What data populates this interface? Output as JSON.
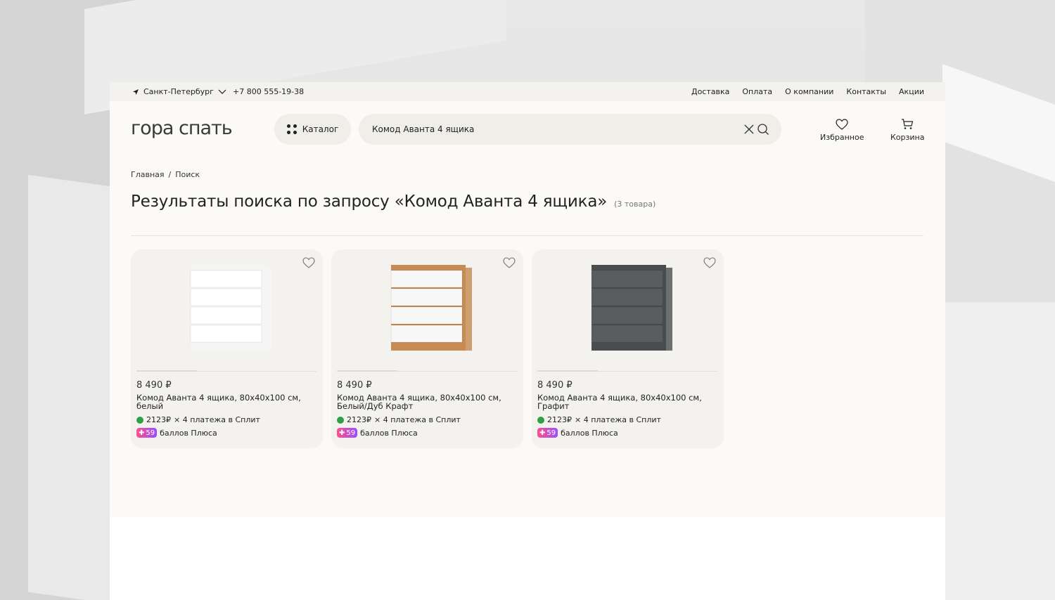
{
  "topbar": {
    "city": "Санкт-Петербург",
    "phone": "+7 800 555-19-38",
    "links": [
      "Доставка",
      "Оплата",
      "О компании",
      "Контакты",
      "Акции"
    ]
  },
  "header": {
    "logo": "гора спать",
    "catalog_label": "Каталог",
    "search_value": "Комод Аванта 4 ящика",
    "favorites_label": "Избранное",
    "cart_label": "Корзина"
  },
  "breadcrumb": {
    "home": "Главная",
    "sep": "/",
    "current": "Поиск"
  },
  "results": {
    "title": "Результаты поиска по запросу «Комод Аванта 4 ящика»",
    "count": "(3 товара)"
  },
  "products": [
    {
      "price": "8 490 ₽",
      "name": "Комод Аванта 4 ящика, 80х40х100 см, белый",
      "split_amount": "2123₽",
      "split_text": "× 4 платежа в Сплит",
      "plus_points": "59",
      "plus_text": "баллов Плюса",
      "body_color": "#f5f5f5",
      "front_color": "#ffffff"
    },
    {
      "price": "8 490 ₽",
      "name": "Комод Аванта 4 ящика, 80х40х100 см, Белый/Дуб Крафт",
      "split_amount": "2123₽",
      "split_text": "× 4 платежа в Сплит",
      "plus_points": "59",
      "plus_text": "баллов Плюса",
      "body_color": "#c68a52",
      "front_color": "#f7f7f7"
    },
    {
      "price": "8 490 ₽",
      "name": "Комод Аванта 4 ящика, 80х40х100 см, Графит",
      "split_amount": "2123₽",
      "split_text": "× 4 платежа в Сплит",
      "plus_points": "59",
      "plus_text": "баллов Плюса",
      "body_color": "#4a4d4f",
      "front_color": "#5a5d60"
    }
  ]
}
